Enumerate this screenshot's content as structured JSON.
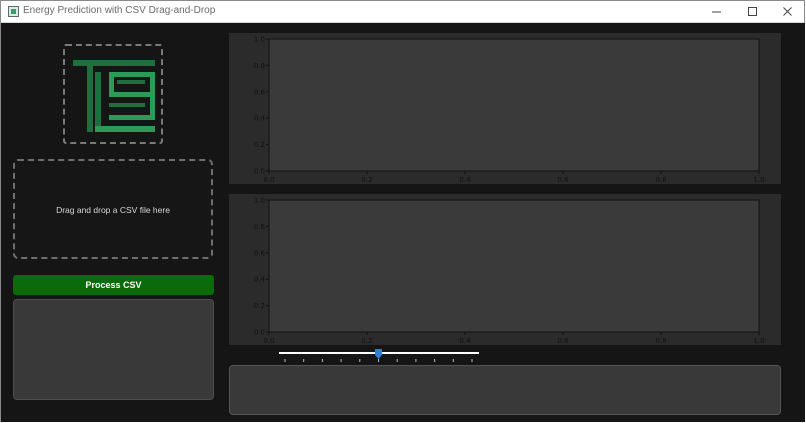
{
  "window": {
    "title": "Energy Prediction with CSV Drag-and-Drop"
  },
  "titlebar_icons": [
    "app-icon",
    "minimize-icon",
    "maximize-icon",
    "close-icon"
  ],
  "logo": {
    "icon": "tl9-logo",
    "colors": [
      "#1f6e3d",
      "#2e9a58"
    ]
  },
  "drop_zone": {
    "text": "Drag and drop a CSV file here"
  },
  "process_button": {
    "label": "Process CSV",
    "color": "#0b6b0b"
  },
  "plots": [
    {
      "type": "line",
      "x_ticks": [
        "0.0",
        "0.2",
        "0.4",
        "0.6",
        "0.8",
        "1.0"
      ],
      "y_ticks": [
        "0.0",
        "0.2",
        "0.4",
        "0.6",
        "0.8",
        "1.0"
      ],
      "xlim": [
        0,
        1
      ],
      "ylim": [
        0,
        1
      ]
    },
    {
      "type": "line",
      "x_ticks": [
        "0.0",
        "0.2",
        "0.4",
        "0.6",
        "0.8",
        "1.0"
      ],
      "y_ticks": [
        "0.0",
        "0.2",
        "0.4",
        "0.6",
        "0.8",
        "1.0"
      ],
      "xlim": [
        0,
        1
      ],
      "ylim": [
        0,
        1
      ]
    }
  ],
  "slider": {
    "value_fraction": 0.5,
    "tick_count": 11,
    "accent": "#2f7ed8"
  },
  "colors": {
    "background": "#151515",
    "panel": "#393939",
    "plot_bg": "#2b2b2b",
    "axes_bg": "#3a3a3a"
  }
}
